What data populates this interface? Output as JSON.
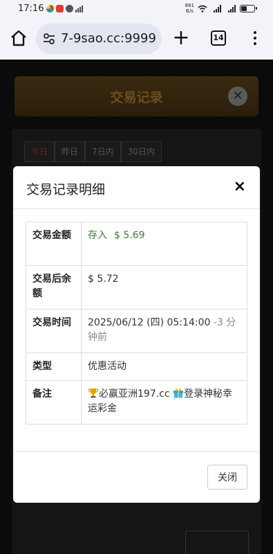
{
  "status_bar": {
    "time": "17:16",
    "net_speed_top": "861",
    "net_speed_bottom": "B/s",
    "signal": "4G"
  },
  "browser": {
    "url": "7-9sao.cc:9999",
    "tab_count": "14",
    "new_tab_symbol": "+"
  },
  "background_page": {
    "title": "交易记录",
    "filters": [
      "今日",
      "昨日",
      "7日内",
      "30日内"
    ]
  },
  "modal": {
    "title": "交易记录明细",
    "close_symbol": "×",
    "rows": {
      "amount": {
        "label": "交易金额",
        "type": "存入",
        "value": "$ 5.69"
      },
      "balance": {
        "label": "交易后余额",
        "value": "$ 5.72"
      },
      "time": {
        "label": "交易时间",
        "value": "2025/06/12 (四) 05:14:00",
        "ago": "-3 分钟前"
      },
      "category": {
        "label": "类型",
        "value": "优惠活动"
      },
      "note": {
        "label": "备注",
        "part1": "必赢亚洲197.cc",
        "part2": "登录神秘幸运彩金"
      }
    },
    "close_button": "关闭"
  },
  "colors": {
    "deposit_green": "#3c7a3c",
    "overlay": "#000000",
    "modal_bg": "#ffffff"
  }
}
